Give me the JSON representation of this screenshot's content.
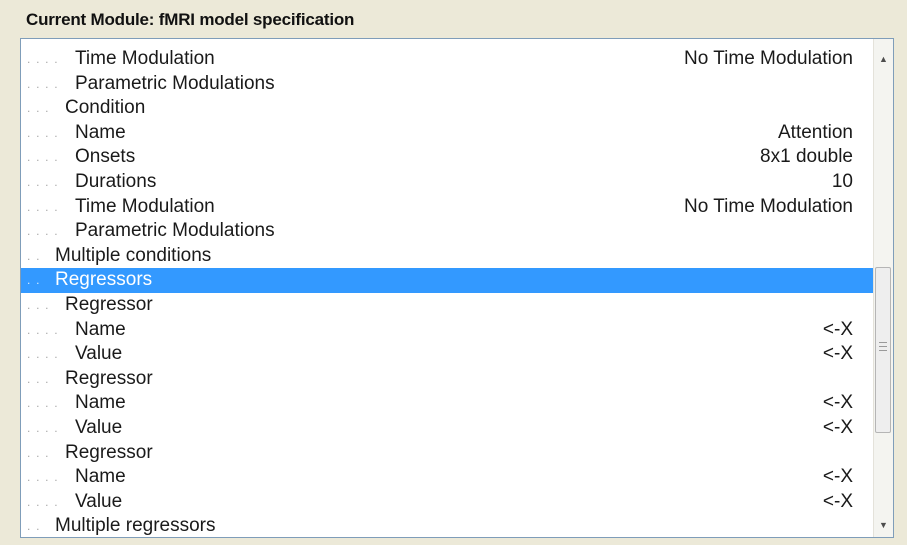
{
  "module": {
    "title": "Current Module: fMRI model specification"
  },
  "tree": {
    "rows": [
      {
        "dots": ". . . . ",
        "label": "Time Modulation",
        "value": "No Time Modulation"
      },
      {
        "dots": ". . . . ",
        "label": "Parametric Modulations",
        "value": ""
      },
      {
        "dots": ". . . ",
        "label": "Condition",
        "value": ""
      },
      {
        "dots": ". . . . ",
        "label": "Name",
        "value": "Attention"
      },
      {
        "dots": ". . . . ",
        "label": "Onsets",
        "value": "8x1 double"
      },
      {
        "dots": ". . . . ",
        "label": "Durations",
        "value": "10"
      },
      {
        "dots": ". . . . ",
        "label": "Time Modulation",
        "value": "No Time Modulation"
      },
      {
        "dots": ". . . . ",
        "label": "Parametric Modulations",
        "value": ""
      },
      {
        "dots": ". . ",
        "label": "Multiple conditions",
        "value": ""
      },
      {
        "dots": ". . ",
        "label": "Regressors",
        "value": "",
        "selected": true
      },
      {
        "dots": ". . . ",
        "label": "Regressor",
        "value": ""
      },
      {
        "dots": ". . . . ",
        "label": "Name",
        "value": "<-X"
      },
      {
        "dots": ". . . . ",
        "label": "Value",
        "value": "<-X"
      },
      {
        "dots": ". . . ",
        "label": "Regressor",
        "value": ""
      },
      {
        "dots": ". . . . ",
        "label": "Name",
        "value": "<-X"
      },
      {
        "dots": ". . . . ",
        "label": "Value",
        "value": "<-X"
      },
      {
        "dots": ". . . ",
        "label": "Regressor",
        "value": ""
      },
      {
        "dots": ". . . . ",
        "label": "Name",
        "value": "<-X"
      },
      {
        "dots": ". . . . ",
        "label": "Value",
        "value": "<-X"
      },
      {
        "dots": ". . ",
        "label": "Multiple regressors",
        "value": ""
      }
    ]
  },
  "scrollbar": {
    "up_icon": "▲",
    "down_icon": "▼"
  },
  "colors": {
    "selection": "#3399ff",
    "window_bg": "#ece9d8"
  }
}
